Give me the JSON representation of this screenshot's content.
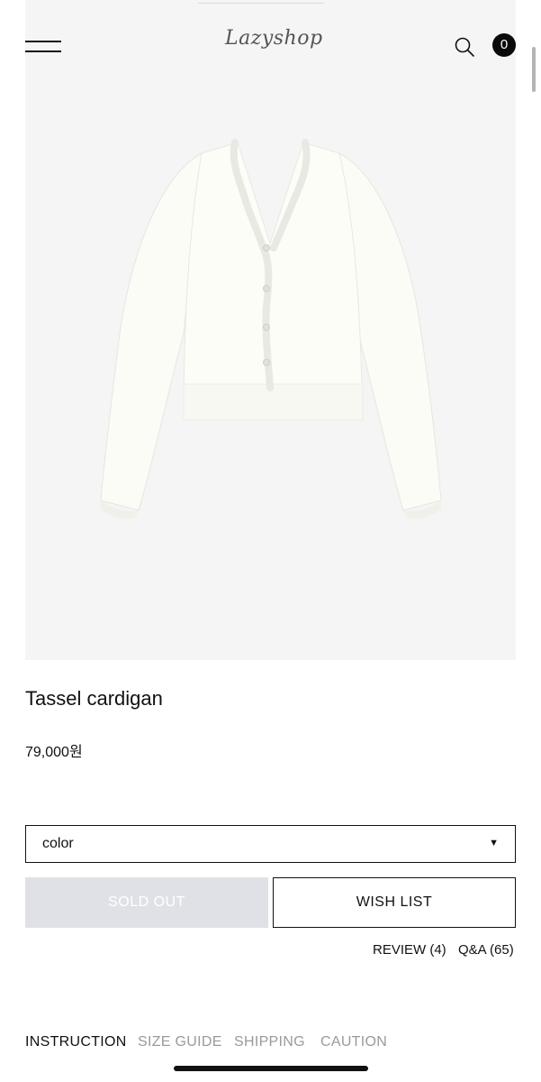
{
  "header": {
    "logo_text": "Lazyshop",
    "cart_count": "0",
    "icons": [
      "hamburger-menu-icon",
      "search-icon",
      "cart-badge"
    ]
  },
  "product": {
    "title": "Tassel cardigan",
    "price": "79,000원",
    "image_subject": "cardigan-image"
  },
  "options": {
    "select_label": "color",
    "select_arrow": "▼"
  },
  "actions": {
    "soldout_label": "SOLD OUT",
    "wishlist_label": "WISH LIST",
    "review_label": "REVIEW (4)",
    "qa_label": "Q&A (65)"
  },
  "tabs": [
    {
      "label": "INSTRUCTION",
      "active": true
    },
    {
      "label": "SIZE GUIDE",
      "active": false
    },
    {
      "label": "SHIPPING",
      "active": false
    },
    {
      "label": "CAUTION",
      "active": false
    }
  ],
  "colors": {
    "image_bg": "#f5f5f5",
    "soldout_bg": "#e0e1e6",
    "text": "#111111",
    "inactive_tab": "#9a9a9a"
  }
}
